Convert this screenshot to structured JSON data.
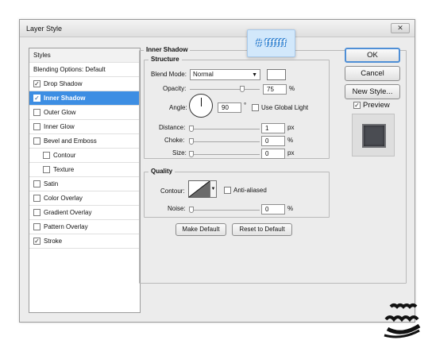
{
  "window": {
    "title": "Layer Style",
    "close_label": "✕"
  },
  "styles_list": {
    "header": "Styles",
    "blending": "Blending Options: Default",
    "items": [
      {
        "label": "Drop Shadow",
        "checked": true
      },
      {
        "label": "Inner Shadow",
        "checked": true,
        "selected": true
      },
      {
        "label": "Outer Glow",
        "checked": false
      },
      {
        "label": "Inner Glow",
        "checked": false
      },
      {
        "label": "Bevel and Emboss",
        "checked": false
      },
      {
        "label": "Contour",
        "checked": false,
        "indent": true
      },
      {
        "label": "Texture",
        "checked": false,
        "indent": true
      },
      {
        "label": "Satin",
        "checked": false
      },
      {
        "label": "Color Overlay",
        "checked": false
      },
      {
        "label": "Gradient Overlay",
        "checked": false
      },
      {
        "label": "Pattern Overlay",
        "checked": false
      },
      {
        "label": "Stroke",
        "checked": true
      }
    ]
  },
  "panel": {
    "title": "Inner Shadow",
    "structure": {
      "legend": "Structure",
      "blend_mode_label": "Blend Mode:",
      "blend_mode_value": "Normal",
      "shadow_color": "#ffffff",
      "opacity_label": "Opacity:",
      "opacity_value": "75",
      "opacity_level": 0.75,
      "percent": "%",
      "angle_label": "Angle:",
      "angle_value": "90",
      "degree": "°",
      "use_global_light": "Use Global Light",
      "distance_label": "Distance:",
      "distance_value": "1",
      "choke_label": "Choke:",
      "choke_value": "0",
      "size_label": "Size:",
      "size_value": "0",
      "px": "px"
    },
    "quality": {
      "legend": "Quality",
      "contour_label": "Contour:",
      "anti_aliased": "Anti-aliased",
      "noise_label": "Noise:",
      "noise_value": "0",
      "percent": "%"
    },
    "make_default": "Make Default",
    "reset_default": "Reset to Default"
  },
  "right_buttons": {
    "ok": "OK",
    "cancel": "Cancel",
    "new_style": "New Style...",
    "preview_label": "Preview",
    "preview_checked": true
  },
  "color_tag": {
    "text": "# ffffff",
    "background": "#d2e8fb"
  },
  "accent": "#3d8ee3"
}
